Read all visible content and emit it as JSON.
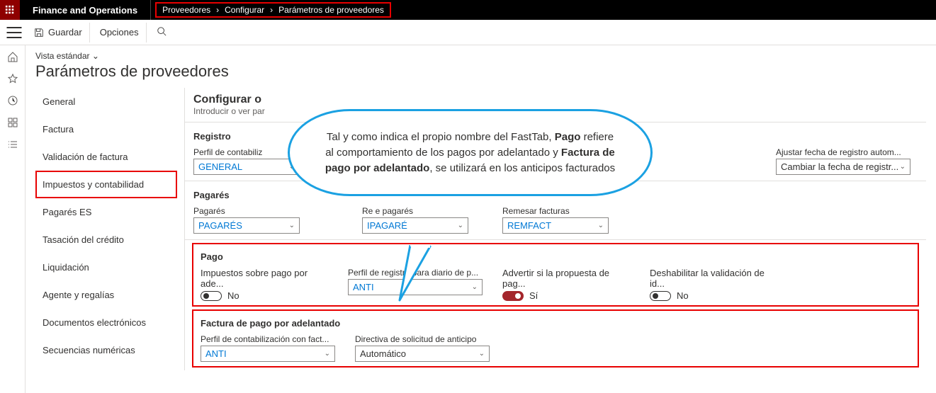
{
  "app_title": "Finance and Operations",
  "breadcrumb": [
    "Proveedores",
    "Configurar",
    "Parámetros de proveedores"
  ],
  "toolbar": {
    "save": "Guardar",
    "options": "Opciones"
  },
  "view_label": "Vista estándar",
  "page_title": "Parámetros de proveedores",
  "side_nav": [
    "General",
    "Factura",
    "Validación de factura",
    "Impuestos y contabilidad",
    "Pagarés ES",
    "Tasación del crédito",
    "Liquidación",
    "Agente y regalías",
    "Documentos electrónicos",
    "Secuencias numéricas"
  ],
  "active_nav_index": 3,
  "form": {
    "header_title": "Configurar o",
    "header_sub": "Introducir o ver par",
    "sections": {
      "registro": {
        "title": "Registro",
        "perfil_label": "Perfil de contabiliz",
        "perfil_value": "GENERAL",
        "ajustar_label": "Ajustar fecha de registro autom...",
        "ajustar_value": "Cambiar la fecha de registr..."
      },
      "pagares": {
        "title": "Pagarés",
        "pagares_label": "Pagarés",
        "pagares_value": "PAGARÉS",
        "remitir_label": "Re         e pagarés",
        "remitir_value": "      IPAGARÉ",
        "remesar_label": "Remesar facturas",
        "remesar_value": "REMFACT"
      },
      "pago": {
        "title": "Pago",
        "impuestos_label": "Impuestos sobre pago por ade...",
        "impuestos_value": "No",
        "perfil_label": "Perfil de registro para diario de p...",
        "perfil_value": "ANTI",
        "advertir_label": "Advertir si la propuesta de pag...",
        "advertir_value": "Sí",
        "deshabilitar_label": "Deshabilitar la validación de id...",
        "deshabilitar_value": "No"
      },
      "factura_pago": {
        "title": "Factura de pago por adelantado",
        "perfil_label": "Perfil de contabilización con fact...",
        "perfil_value": "ANTI",
        "directiva_label": "Directiva de solicitud de anticipo",
        "directiva_value": "Automático"
      }
    }
  },
  "callout": {
    "pre": "Tal y como indica el propio nombre del FastTab, ",
    "b1": "Pago",
    "mid": " refiere al comportamiento de los pagos por adelantado y ",
    "b2": "Factura de pago por adelantado",
    "post": ", se utilizará en los anticipos facturados"
  }
}
